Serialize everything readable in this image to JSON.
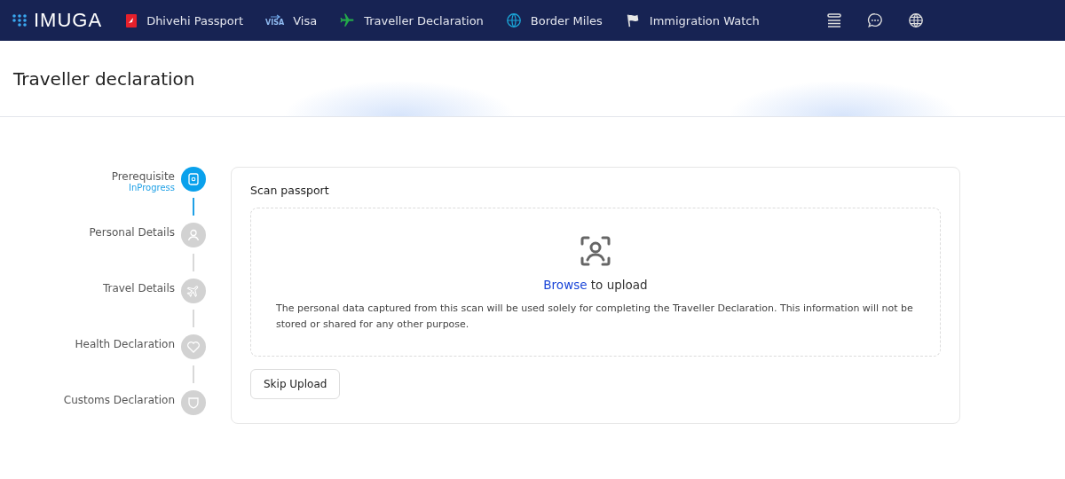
{
  "brand": {
    "name": "IMUGA"
  },
  "nav": [
    {
      "label": "Dhivehi Passport"
    },
    {
      "label": "Visa",
      "icon_text": "VISA"
    },
    {
      "label": "Traveller Declaration"
    },
    {
      "label": "Border Miles"
    },
    {
      "label": "Immigration Watch"
    }
  ],
  "page": {
    "title": "Traveller declaration"
  },
  "steps": [
    {
      "label": "Prerequisite",
      "status": "InProgress",
      "selected": true
    },
    {
      "label": "Personal Details",
      "selected": false
    },
    {
      "label": "Travel Details",
      "selected": false
    },
    {
      "label": "Health Declaration",
      "selected": false
    },
    {
      "label": "Customs Declaration",
      "selected": false
    }
  ],
  "card": {
    "title": "Scan passport",
    "upload_link": "Browse",
    "upload_text": "to upload",
    "notice": "The personal data captured from this scan will be used solely for completing the Traveller Declaration. This information will not be stored or shared for any other purpose.",
    "button": "Skip Upload"
  }
}
